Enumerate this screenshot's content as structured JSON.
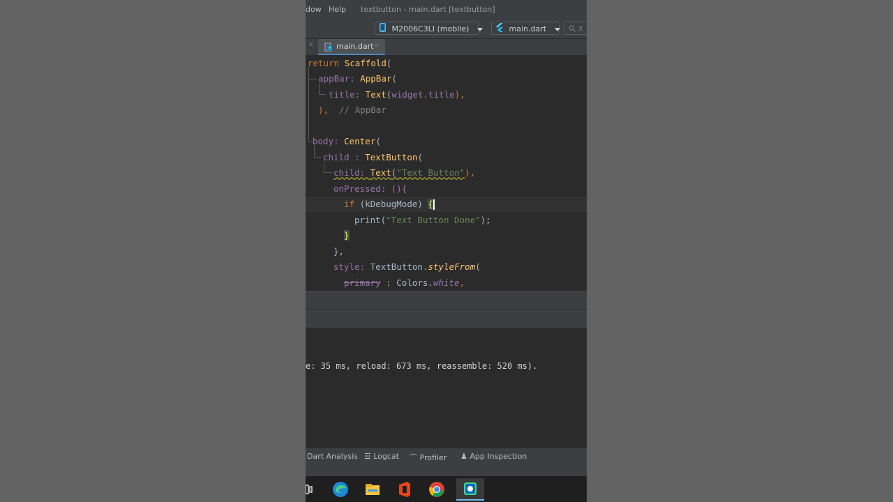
{
  "menu": {
    "window_partial": "dow",
    "help": "Help",
    "title": "textbutton - main.dart [textbutton]"
  },
  "toolbar": {
    "device": "M2006C3LI (mobile)",
    "config": "main.dart",
    "extra_partial": "X"
  },
  "tab": {
    "label": "main.dart"
  },
  "code": {
    "l1_kw": "return",
    "l1_cls": "Scaffold",
    "l1_tail": "(",
    "l2_prop": "appBar: ",
    "l2_cls": "AppBar",
    "l2_tail": "(",
    "l3_prop": "title: ",
    "l3_cls": "Text",
    "l3_open": "(",
    "l3_arg": "widget.title",
    "l3_close": "),",
    "l4_text": "),",
    "l4_cmt": "// AppBar",
    "l5_prop": "body: ",
    "l5_cls": "Center",
    "l5_tail": "(",
    "l6_prop": "child : ",
    "l6_cls": "TextButton",
    "l6_tail": "(",
    "l7_prop": "child: ",
    "l7_cls": "Text",
    "l7_open": "(",
    "l7_str": "\"Text Button\"",
    "l7_close": "),",
    "l8_text": "onPressed: (){",
    "l9_kw": "if",
    "l9_text": " (kDebugMode) ",
    "l9_brace": "{",
    "l10_text": "print(",
    "l10_str": "\"Text Button Done\"",
    "l10_tail": ");",
    "l11_brace": "}",
    "l12_text": "},",
    "l13_prop": "style: ",
    "l13_text": "TextButton.",
    "l13_fn": "styleFrom",
    "l13_tail": "(",
    "l14_strike": "primary",
    "l14_text": " : Colors.",
    "l14_prop": "white",
    "l14_tail": ","
  },
  "console": {
    "line": "e: 35 ms, reload: 673 ms, reassemble: 520 ms)."
  },
  "toolwindows": {
    "dart_analysis": "Dart Analysis",
    "logcat": "Logcat",
    "profiler": "Profiler",
    "app_inspection": "App Inspection"
  },
  "taskbar": {
    "items": [
      "task-view",
      "edge",
      "file-explorer",
      "office",
      "chrome",
      "app"
    ]
  },
  "colors": {
    "editor_bg": "#2b2b2b",
    "keyword": "#cc7832",
    "class": "#ffc66d",
    "property": "#9876aa",
    "string": "#6a8759",
    "comment": "#808080"
  }
}
